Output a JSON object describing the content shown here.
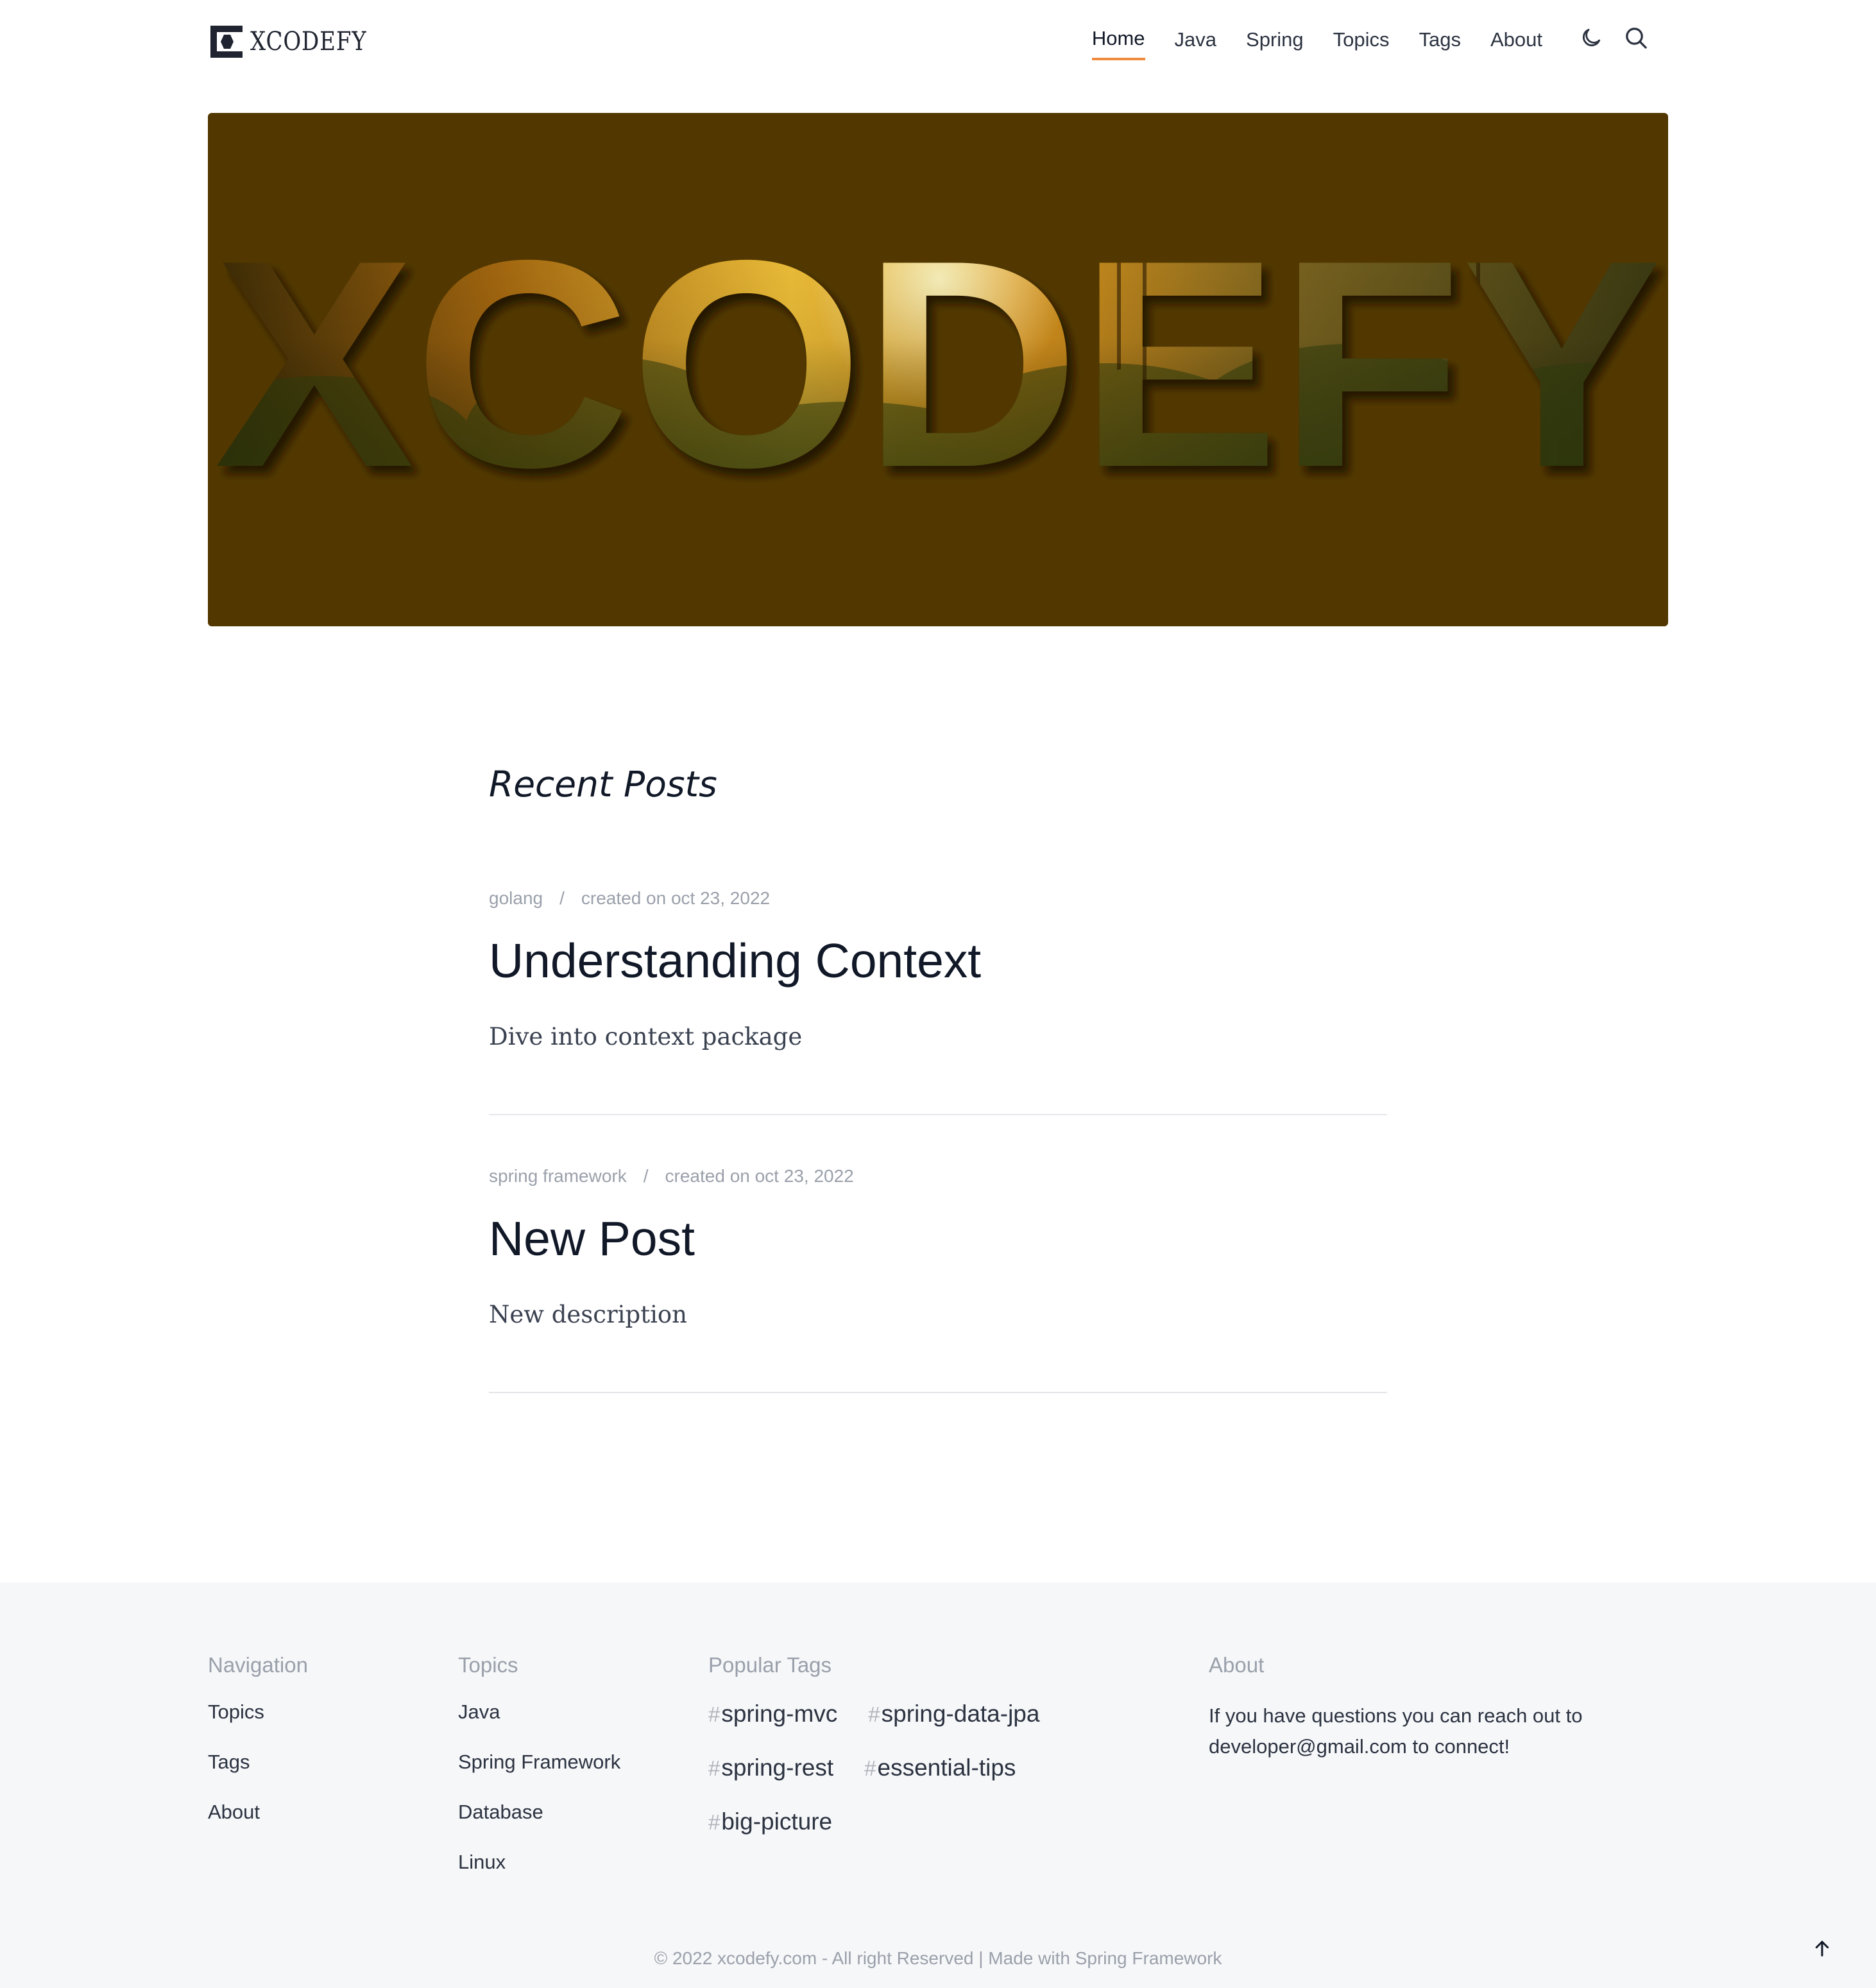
{
  "brand": {
    "name": "XCODEFY"
  },
  "nav": {
    "items": [
      {
        "label": "Home",
        "active": true
      },
      {
        "label": "Java",
        "active": false
      },
      {
        "label": "Spring",
        "active": false
      },
      {
        "label": "Topics",
        "active": false
      },
      {
        "label": "Tags",
        "active": false
      },
      {
        "label": "About",
        "active": false
      }
    ],
    "theme_icon": "moon-icon",
    "search_icon": "search-icon"
  },
  "hero": {
    "text": "XCODEFY",
    "background": "#523800"
  },
  "recent": {
    "title": "Recent Posts",
    "posts": [
      {
        "category": "golang",
        "separator": "/",
        "created": "created on oct 23, 2022",
        "title": "Understanding Context",
        "description": "Dive into context package"
      },
      {
        "category": "spring framework",
        "separator": "/",
        "created": "created on oct 23, 2022",
        "title": "New Post",
        "description": "New description"
      }
    ]
  },
  "footer": {
    "navigation": {
      "heading": "Navigation",
      "links": [
        "Topics",
        "Tags",
        "About"
      ]
    },
    "topics": {
      "heading": "Topics",
      "links": [
        "Java",
        "Spring Framework",
        "Database",
        "Linux"
      ]
    },
    "tags": {
      "heading": "Popular Tags",
      "hash": "#",
      "items": [
        "spring-mvc",
        "spring-data-jpa",
        "spring-rest",
        "essential-tips",
        "big-picture"
      ]
    },
    "about": {
      "heading": "About",
      "text": "If you have questions you can reach out to developer@gmail.com to connect!"
    },
    "copyright": "© 2022 xcodefy.com - All right Reserved | Made with Spring Framework",
    "to_top_icon": "arrow-up-icon"
  },
  "colors": {
    "accent": "#f08a3c",
    "hero_bg": "#523800",
    "footer_bg": "#f6f7f9"
  }
}
